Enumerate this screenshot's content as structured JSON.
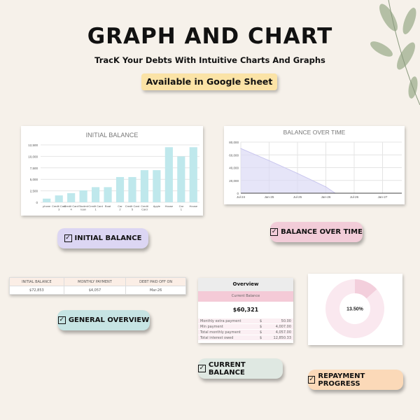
{
  "header": {
    "title": "GRAPH AND CHART",
    "subtitle": "TracK Your Debts With Intuitive Charts And Graphs",
    "badge": "Available in Google Sheet"
  },
  "labels": {
    "initial_balance": "INITIAL BALANCE",
    "balance_over_time": "BALANCE OVER TIME",
    "general_overview": "GENERAL OVERVIEW",
    "current_balance": "CURRENT BALANCE",
    "repayment_progress": "REPAYMENT PROGRESS"
  },
  "summary_table": {
    "headers": [
      "INITIAL BALANCE",
      "MONTHLY PAYMENT",
      "DEBT PAID OFF ON"
    ],
    "values": [
      "$72,853",
      "$4,057",
      "Mar-26"
    ]
  },
  "overview": {
    "title": "Overview",
    "current_label": "Current Balance",
    "current_value": "$60,321",
    "rows": [
      {
        "label": "Monthly extra payment",
        "cur": "$",
        "value": "50.00"
      },
      {
        "label": "Min payment",
        "cur": "$",
        "value": "4,007.00"
      },
      {
        "label": "Total monthly payment",
        "cur": "$",
        "value": "4,057.00"
      },
      {
        "label": "Total interest owed",
        "cur": "$",
        "value": "12,850.33"
      }
    ]
  },
  "chart_data": [
    {
      "type": "bar",
      "title": "INITIAL BALANCE",
      "categories": [
        "phone",
        "Credit Card 3",
        "Credit Card 4",
        "Student loan",
        "Credit Card 1",
        "Boat",
        "Car 2",
        "Credit Card 5",
        "Credit Card",
        "Apple",
        "House",
        "Car 1",
        "House"
      ],
      "values": [
        800,
        1500,
        2000,
        2600,
        3300,
        3300,
        5500,
        5500,
        7000,
        7000,
        12000,
        10000,
        12000
      ],
      "yticks": [
        "0",
        "2,500",
        "5,000",
        "7,500",
        "10,000",
        "12,500"
      ],
      "ylim": [
        0,
        12500
      ],
      "grid": true,
      "color": "#bfe8ec"
    },
    {
      "type": "area",
      "title": "BALANCE OVER TIME",
      "x": [
        "Jul-24",
        "Jan-25",
        "Jul-25",
        "Jan-26",
        "Mar-26"
      ],
      "values": [
        70000,
        51000,
        31000,
        10000,
        0
      ],
      "xticks": [
        "Jul-24",
        "Jan-25",
        "Jul-25",
        "Jan-26",
        "Jul-26",
        "Jan-27"
      ],
      "yticks": [
        "0",
        "20,000",
        "40,000",
        "60,000",
        "80,000"
      ],
      "ylim": [
        0,
        80000
      ],
      "grid": true,
      "color": "#dcdaf5"
    },
    {
      "type": "pie",
      "title": "",
      "center_label": "13.50%",
      "values": [
        13.5,
        86.5
      ],
      "colors": [
        "#f3cfdc",
        "#fae8ef"
      ]
    }
  ]
}
